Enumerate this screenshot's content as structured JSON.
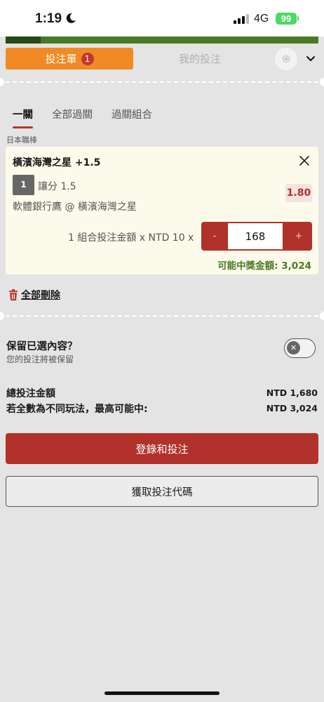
{
  "status_bar": {
    "time": "1:19",
    "network": "4G",
    "battery": "99"
  },
  "tabs": {
    "bet_slip_label": "投注單",
    "bet_slip_count": "1",
    "my_bets_label": "我的投注"
  },
  "sub_tabs": [
    "一關",
    "全部過關",
    "過關組合"
  ],
  "league": "日本職棒",
  "bet": {
    "title": "橫濱海灣之星 +1.5",
    "index": "1",
    "market": "讓分 1.5",
    "odds": "1.80",
    "match": "軟體銀行鷹 @ 橫濱海灣之星",
    "stake_label": "1 組合投注金額 x NTD 10 x",
    "stake_value": "168",
    "minus": "-",
    "plus": "+",
    "payout": "可能中獎金額: 3,024"
  },
  "delete_all": "全部刪除",
  "keep": {
    "title": "保留已選內容？",
    "subtitle": "您的投注將被保留",
    "enabled": false
  },
  "summary": {
    "total_label": "總投注金額",
    "total_value": "NTD 1,680",
    "max_label": "若全數為不同玩法，最高可能中:",
    "max_value": "NTD 3,024"
  },
  "buttons": {
    "login_bet": "登錄和投注",
    "get_code": "獲取投注代碼"
  },
  "colors": {
    "accent_orange": "#f08a24",
    "primary_red": "#b0322a",
    "win_green": "#4a7a25"
  }
}
